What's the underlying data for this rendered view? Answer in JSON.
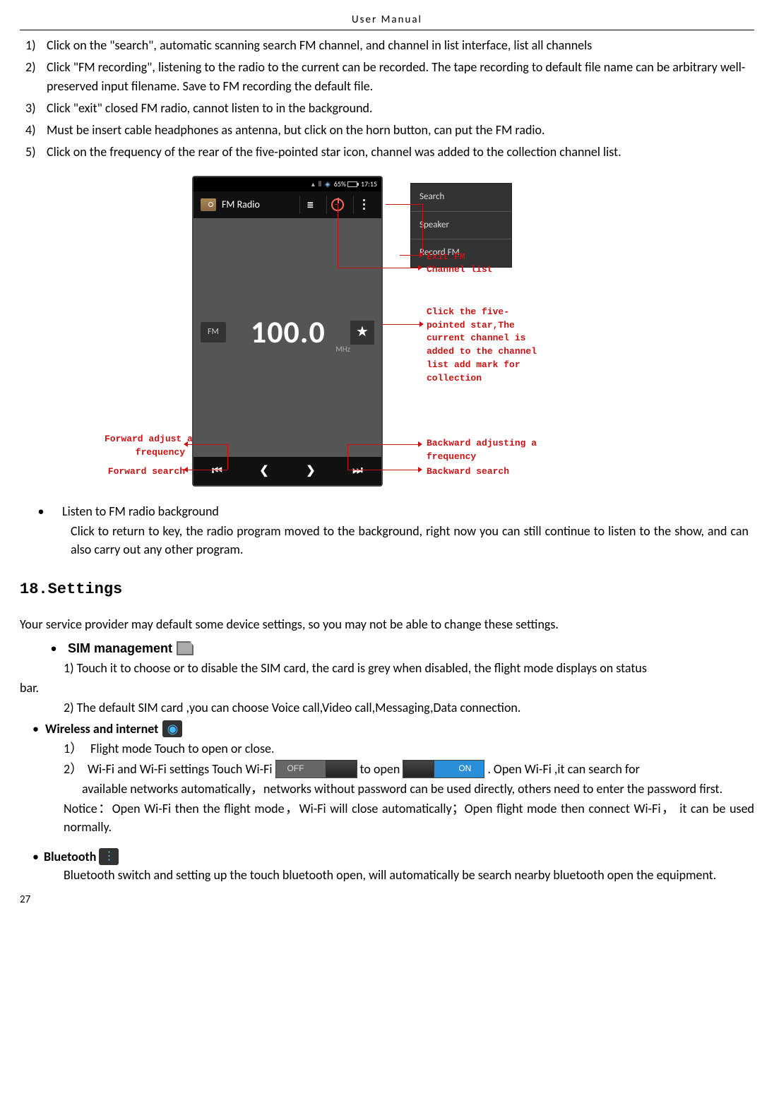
{
  "header": "User    Manual",
  "list_items": [
    "Click on the \"search\", automatic scanning search FM channel, and channel in list interface, list all channels",
    "Click \"FM recording\", listening to the radio to the current can be recorded. The tape recording to default file name can be arbitrary well-preserved input filename. Save to FM recording the default file.",
    "Click \"exit\" closed FM radio, cannot listen to in the background.",
    "Must be insert cable headphones as antenna, but click on the horn button, can put the FM radio.",
    "Click on the frequency of the rear of the five-pointed star icon, channel was added to the collection channel list."
  ],
  "figure": {
    "status_time": "17:15",
    "batt_pct": "65%",
    "app_title": "FM Radio",
    "popup": [
      "Search",
      "Speaker",
      "Record FM"
    ],
    "fm_label": "FM",
    "freq": "100.0",
    "mhz": "MHz",
    "star": "★",
    "callouts": {
      "exit_fm": "Exit FM",
      "channel_list": "Channel list",
      "star_note": "Click the five-\npointed star,The\ncurrent channel is\nadded to the channel\nlist add mark for\ncollection",
      "fwd_adj": "Forward adjust a\nfrequency",
      "fwd_search": "Forward search",
      "back_adj": "Backward adjusting a\nfrequency",
      "back_search": "Backward search"
    }
  },
  "listen_bg": {
    "title": "Listen to FM radio background",
    "body": "Click to return to key, the radio program moved to the background, right now you can still continue to listen to the show, and can also carry out any other program."
  },
  "section18": "18.Settings",
  "intro18": "Your service provider may default some device settings, so you may not be able to change these settings.",
  "sim": {
    "heading": "SIM management",
    "line1a": "1) Touch it to choose or to disable the SIM card, the card is grey when disabled, the flight mode displays on status",
    "line1b": "bar.",
    "line2": "2) The default SIM card ,you can choose Voice call,Video call,Messaging,Data connection."
  },
  "wifi": {
    "heading": "Wireless and internet",
    "li1_num": "1）",
    "li1": "Flight mode      Touch to open or close.",
    "li2_num": "2）",
    "li2_a": "Wi-Fi and Wi-Fi settings       Touch Wi-Fi",
    "li2_b": "to open",
    "li2_c": ". Open Wi-Fi ,it can search for",
    "li2_body": "available networks automatically，networks without password can be used directly, others need to enter the password first.",
    "off": "OFF",
    "on": "ON",
    "notice": "Notice：Open Wi-Fi then the flight mode，Wi-Fi will close automatically；Open flight mode then connect Wi-Fi， it can be used normally."
  },
  "bt": {
    "heading": "Bluetooth",
    "body": "Bluetooth switch and setting up the touch bluetooth open, will automatically be search nearby bluetooth open the equipment."
  },
  "page": "27"
}
